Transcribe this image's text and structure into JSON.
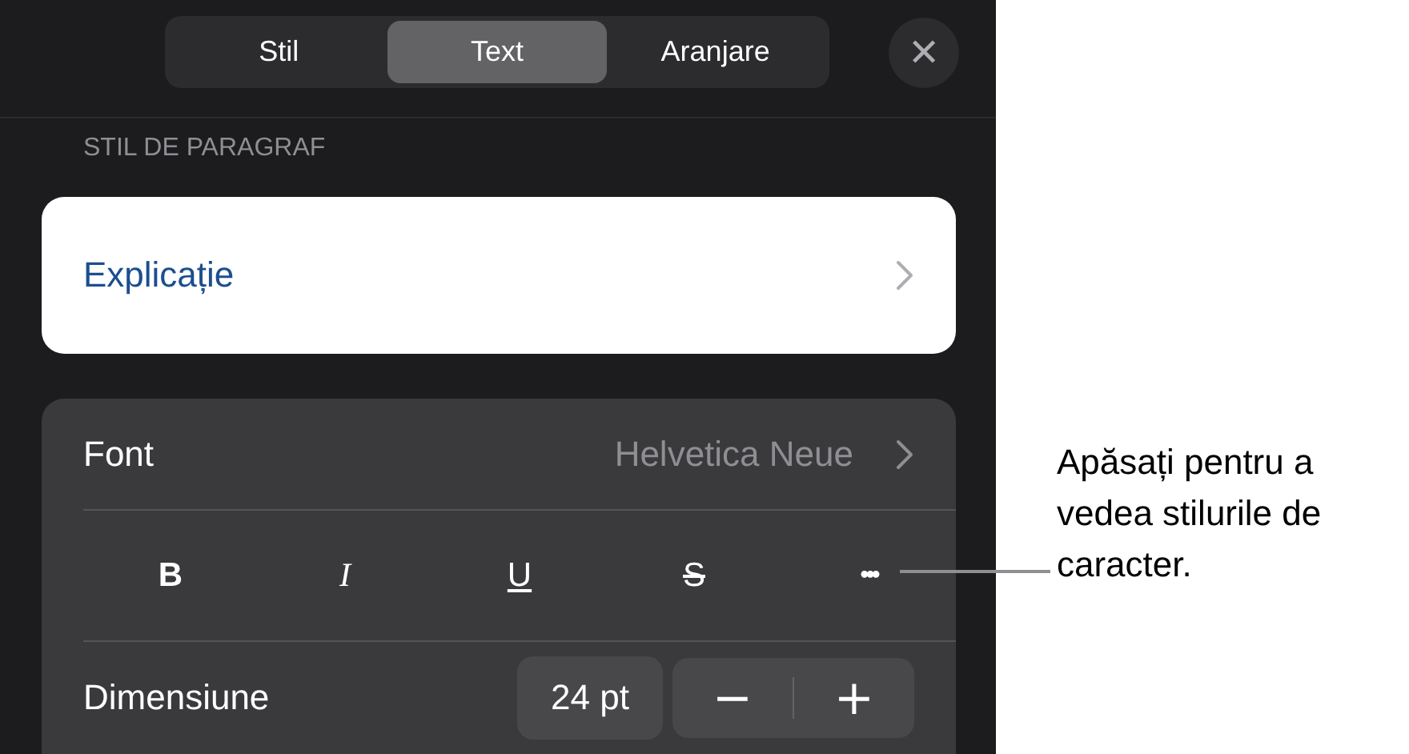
{
  "tabs": [
    {
      "label": "Stil",
      "selected": false
    },
    {
      "label": "Text",
      "selected": true
    },
    {
      "label": "Aranjare",
      "selected": false
    }
  ],
  "close_button": {
    "label": "✕"
  },
  "paragraph_style": {
    "header": "STIL DE PARAGRAF",
    "value": "Explicație"
  },
  "font": {
    "label": "Font",
    "value": "Helvetica Neue"
  },
  "style_buttons": [
    {
      "kind": "bold",
      "label": "B"
    },
    {
      "kind": "italic",
      "label": "I"
    },
    {
      "kind": "underline",
      "label": "U"
    },
    {
      "kind": "strikethrough",
      "label": "S"
    },
    {
      "kind": "more",
      "label": "•••"
    }
  ],
  "size": {
    "label": "Dimensiune",
    "value": "24 pt",
    "decrease": "−",
    "increase": "+"
  },
  "callout": "Apăsați pentru a vedea stilurile de caracter."
}
